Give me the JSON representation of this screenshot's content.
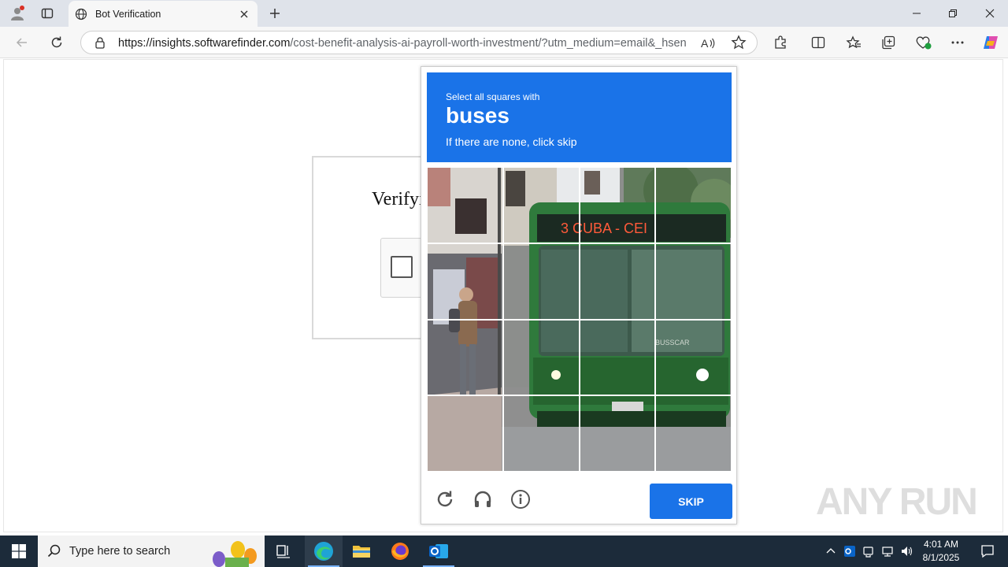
{
  "browser": {
    "tab_title": "Bot Verification",
    "url_host": "https://insights.softwarefinder.com",
    "url_path": "/cost-benefit-analysis-ai-payroll-worth-investment/?utm_medium=email&_hsen..."
  },
  "page": {
    "verify_title": "Verifying"
  },
  "captcha": {
    "instruction": "Select all squares with",
    "target": "buses",
    "subtext": "If there are none, click skip",
    "bus_sign": "3  CUBA - CEI",
    "bus_brand": "BUSSCAR",
    "skip_label": "SKIP",
    "tiles_selected": []
  },
  "watermark": "ANY RUN",
  "taskbar": {
    "search_placeholder": "Type here to search",
    "time": "4:01 AM",
    "date": "8/1/2025"
  },
  "colors": {
    "accent": "#1a73e8",
    "bus_green": "#2f7a3c",
    "taskbar": "#1c2b3a"
  }
}
